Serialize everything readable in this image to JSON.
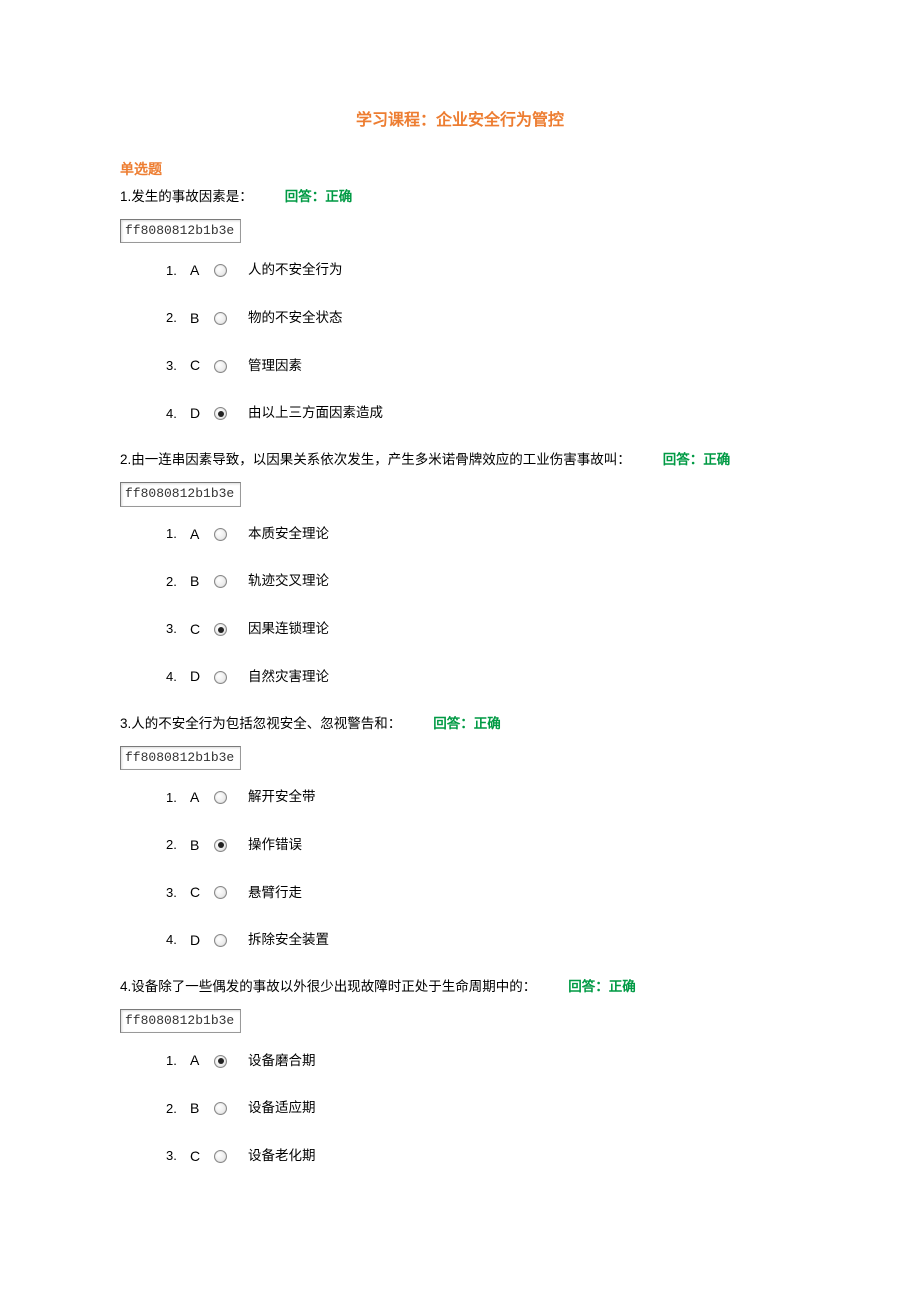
{
  "title": "学习课程：企业安全行为管控",
  "sectionHeading": "单选题",
  "answerLabel": "回答：正确",
  "codeValue": "ff8080812b1b3e",
  "questions": [
    {
      "num": "1.",
      "stem": "发生的事故因素是：",
      "options": [
        {
          "idx": "1.",
          "letter": "A",
          "text": "人的不安全行为",
          "selected": false
        },
        {
          "idx": "2.",
          "letter": "B",
          "text": "物的不安全状态",
          "selected": false
        },
        {
          "idx": "3.",
          "letter": "C",
          "text": "管理因素",
          "selected": false
        },
        {
          "idx": "4.",
          "letter": "D",
          "text": "由以上三方面因素造成",
          "selected": true
        }
      ]
    },
    {
      "num": "2.",
      "stem": "由一连串因素导致，以因果关系依次发生，产生多米诺骨牌效应的工业伤害事故叫：",
      "options": [
        {
          "idx": "1.",
          "letter": "A",
          "text": "本质安全理论",
          "selected": false
        },
        {
          "idx": "2.",
          "letter": "B",
          "text": "轨迹交叉理论",
          "selected": false
        },
        {
          "idx": "3.",
          "letter": "C",
          "text": "因果连锁理论",
          "selected": true
        },
        {
          "idx": "4.",
          "letter": "D",
          "text": "自然灾害理论",
          "selected": false
        }
      ]
    },
    {
      "num": "3.",
      "stem": "人的不安全行为包括忽视安全、忽视警告和：",
      "options": [
        {
          "idx": "1.",
          "letter": "A",
          "text": "解开安全带",
          "selected": false
        },
        {
          "idx": "2.",
          "letter": "B",
          "text": "操作错误",
          "selected": true
        },
        {
          "idx": "3.",
          "letter": "C",
          "text": "悬臂行走",
          "selected": false
        },
        {
          "idx": "4.",
          "letter": "D",
          "text": "拆除安全装置",
          "selected": false
        }
      ]
    },
    {
      "num": "4.",
      "stem": "设备除了一些偶发的事故以外很少出现故障时正处于生命周期中的：",
      "options": [
        {
          "idx": "1.",
          "letter": "A",
          "text": "设备磨合期",
          "selected": true
        },
        {
          "idx": "2.",
          "letter": "B",
          "text": "设备适应期",
          "selected": false
        },
        {
          "idx": "3.",
          "letter": "C",
          "text": "设备老化期",
          "selected": false
        }
      ]
    }
  ]
}
